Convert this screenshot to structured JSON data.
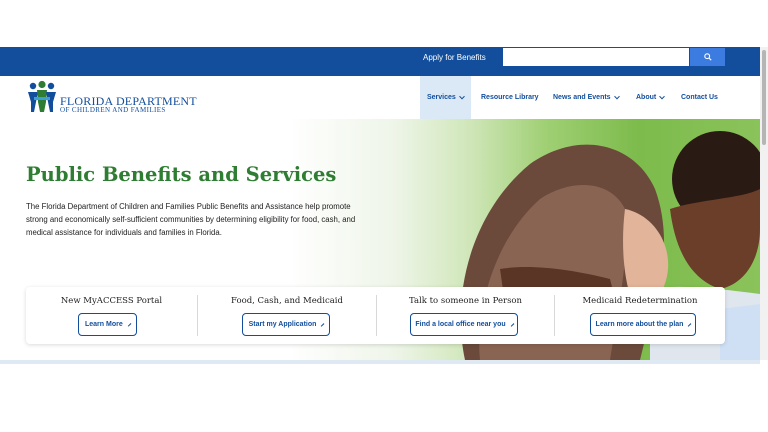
{
  "topbar": {
    "apply_label": "Apply for Benefits",
    "search_placeholder": "",
    "search_icon": "search-icon"
  },
  "logo": {
    "line1": "FLORIDA DEPARTMENT",
    "line2": "OF CHILDREN AND FAMILIES"
  },
  "nav": {
    "items": [
      {
        "label": "Services"
      },
      {
        "label": "Resource Library"
      },
      {
        "label": "News and Events"
      },
      {
        "label": "About"
      },
      {
        "label": "Contact Us"
      }
    ]
  },
  "hero": {
    "title": "Public Benefits and Services",
    "description": "The Florida Department of Children and Families Public Benefits and Assistance help promote strong and economically self-sufficient communities by determining eligibility for food, cash, and medical assistance for individuals and families in Florida."
  },
  "cards": [
    {
      "title": "New MyACCESS Portal",
      "button": "Learn More"
    },
    {
      "title": "Food, Cash, and Medicaid",
      "button": "Start my Application"
    },
    {
      "title": "Talk to someone in Person",
      "button": "Find a local office near you"
    },
    {
      "title": "Medicaid Redetermination",
      "button": "Learn more about the plan"
    }
  ],
  "colors": {
    "brand_blue": "#124e9c",
    "title_green": "#2e7d32",
    "search_button": "#3c7be0"
  }
}
